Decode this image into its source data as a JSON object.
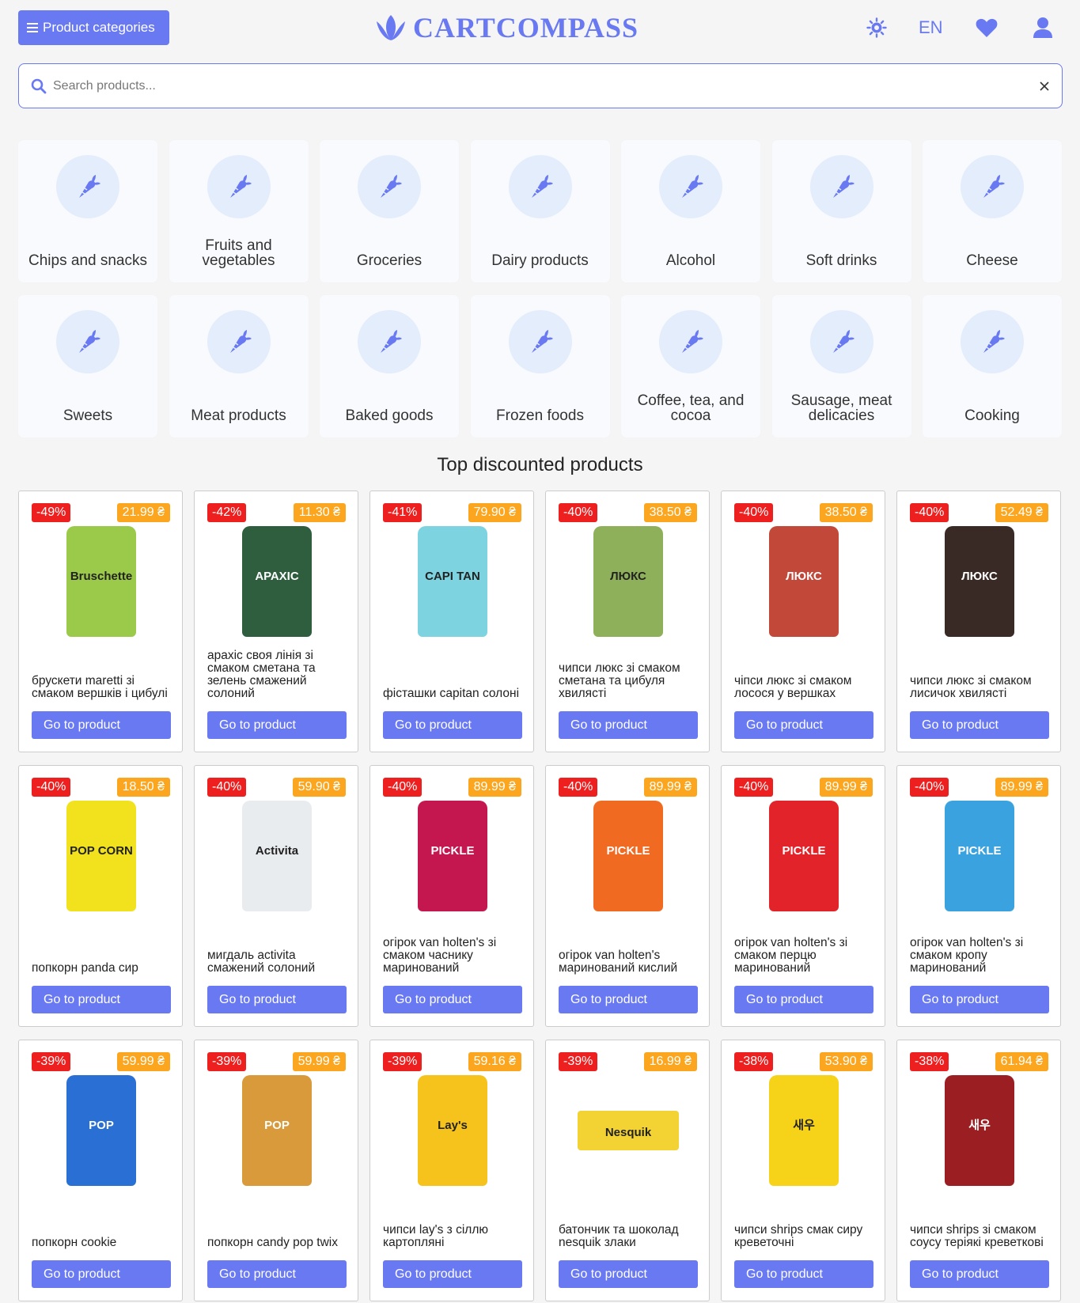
{
  "header": {
    "categories_button": "Product categories",
    "logo_text": "CARTCOMPASS",
    "language": "EN",
    "icons": [
      "theme-toggle-icon",
      "heart-icon",
      "user-icon"
    ],
    "accent_color": "#6979f1"
  },
  "search": {
    "placeholder": "Search products...",
    "value": ""
  },
  "categories": [
    {
      "label": "Chips and snacks"
    },
    {
      "label": "Fruits and vegetables"
    },
    {
      "label": "Groceries"
    },
    {
      "label": "Dairy products"
    },
    {
      "label": "Alcohol"
    },
    {
      "label": "Soft drinks"
    },
    {
      "label": "Cheese"
    },
    {
      "label": "Sweets"
    },
    {
      "label": "Meat products"
    },
    {
      "label": "Baked goods"
    },
    {
      "label": "Frozen foods"
    },
    {
      "label": "Coffee, tea, and cocoa"
    },
    {
      "label": "Sausage, meat delicacies"
    },
    {
      "label": "Cooking"
    }
  ],
  "section_title": "Top discounted products",
  "button_label": "Go to product",
  "products": [
    {
      "discount": "-49%",
      "price": "21.99 ₴",
      "name": "брускети maretti зі смаком вершків і цибулі",
      "pack_color": "#9bc94a",
      "pack_text": "Bruschette"
    },
    {
      "discount": "-42%",
      "price": "11.30 ₴",
      "name": "арахіс своя лінія зі смаком сметана та зелень смажений солоний",
      "pack_color": "#2f5e3f",
      "pack_text": "АРАХІС"
    },
    {
      "discount": "-41%",
      "price": "79.90 ₴",
      "name": "фісташки capitan солоні",
      "pack_color": "#7dd3df",
      "pack_text": "CAPI TAN"
    },
    {
      "discount": "-40%",
      "price": "38.50 ₴",
      "name": "чипси люкс зі смаком сметана та цибуля хвилясті",
      "pack_color": "#8fb05a",
      "pack_text": "ЛЮКС"
    },
    {
      "discount": "-40%",
      "price": "38.50 ₴",
      "name": "чіпси люкс зі смаком лосося у вершках",
      "pack_color": "#c2483a",
      "pack_text": "ЛЮКС"
    },
    {
      "discount": "-40%",
      "price": "52.49 ₴",
      "name": "чипси люкс зі смаком лисичок хвилясті",
      "pack_color": "#3a2a25",
      "pack_text": "ЛЮКС"
    },
    {
      "discount": "-40%",
      "price": "18.50 ₴",
      "name": "попкорн panda сир",
      "pack_color": "#f2e21d",
      "pack_text": "POP CORN"
    },
    {
      "discount": "-40%",
      "price": "59.90 ₴",
      "name": "мигдаль activita смажений солоний",
      "pack_color": "#e9ecef",
      "pack_text": "Activita"
    },
    {
      "discount": "-40%",
      "price": "89.99 ₴",
      "name": "огірок van holten's зі смаком часнику маринований",
      "pack_color": "#c4164f",
      "pack_text": "PICKLE"
    },
    {
      "discount": "-40%",
      "price": "89.99 ₴",
      "name": "огірок van holten's маринований кислий",
      "pack_color": "#f16a22",
      "pack_text": "PICKLE"
    },
    {
      "discount": "-40%",
      "price": "89.99 ₴",
      "name": "огірок van holten's зі смаком перцю маринований",
      "pack_color": "#e3232a",
      "pack_text": "PICKLE"
    },
    {
      "discount": "-40%",
      "price": "89.99 ₴",
      "name": "огірок van holten's зі смаком кропу маринований",
      "pack_color": "#3ba2e0",
      "pack_text": "PICKLE"
    },
    {
      "discount": "-39%",
      "price": "59.99 ₴",
      "name": "попкорн cookie",
      "pack_color": "#2a6fd4",
      "pack_text": "POP"
    },
    {
      "discount": "-39%",
      "price": "59.99 ₴",
      "name": "попкорн candy pop twix",
      "pack_color": "#d89a3a",
      "pack_text": "POP"
    },
    {
      "discount": "-39%",
      "price": "59.16 ₴",
      "name": "чипси lay's з сіллю картопляні",
      "pack_color": "#f6c31c",
      "pack_text": "Lay's"
    },
    {
      "discount": "-39%",
      "price": "16.99 ₴",
      "name": "батончик та шоколад nesquik злаки",
      "pack_color": "#f3d233",
      "pack_text": "Nesquik"
    },
    {
      "discount": "-38%",
      "price": "53.90 ₴",
      "name": "чипси shrips смак сиру креветочні",
      "pack_color": "#f6d219",
      "pack_text": "새우"
    },
    {
      "discount": "-38%",
      "price": "61.94 ₴",
      "name": "чипси shrips зі смаком соусу теріякі креветкові",
      "pack_color": "#9b1f22",
      "pack_text": "새우"
    }
  ]
}
